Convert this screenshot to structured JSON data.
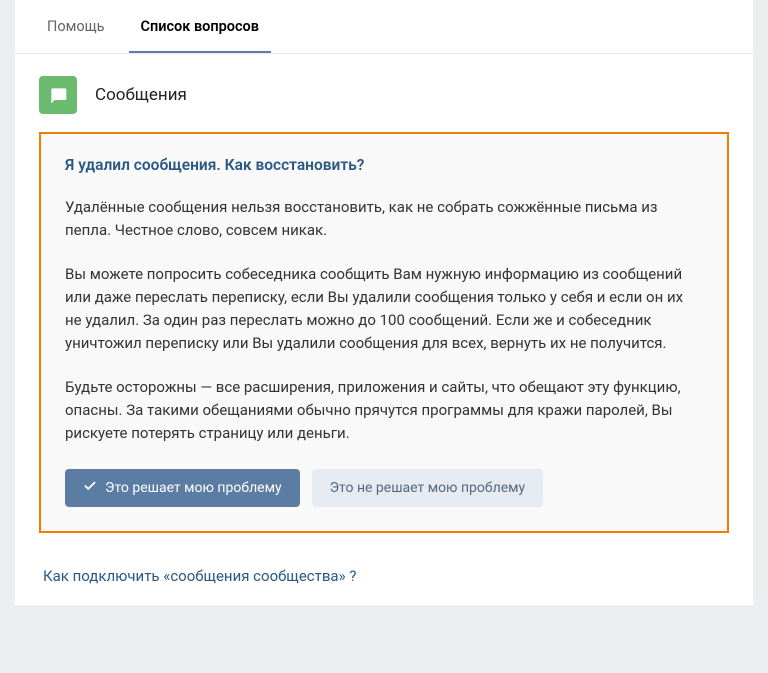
{
  "tabs": {
    "help": "Помощь",
    "questions": "Список вопросов"
  },
  "section": {
    "title": "Сообщения"
  },
  "question": {
    "title": "Я удалил сообщения. Как восстановить?",
    "paragraph1": "Удалённые сообщения нельзя восстановить, как не собрать сожжённые письма из пепла. Честное слово, совсем никак.",
    "paragraph2": "Вы можете попросить собеседника сообщить Вам нужную информацию из сообщений или даже переслать переписку, если Вы удалили сообщения только у себя и если он их не удалил. За один раз переслать можно до 100 сообщений. Если же и собеседник уничтожил переписку или Вы удалили сообщения для всех, вернуть их не получится.",
    "paragraph3": "Будьте осторожны — все расширения, приложения и сайты, что обещают эту функцию, опасны. За такими обещаниями обычно прячутся программы для кражи паролей, Вы рискуете потерять страницу или деньги."
  },
  "buttons": {
    "solves": "Это решает мою проблему",
    "notsolves": "Это не решает мою проблему"
  },
  "related": {
    "link1": "Как подключить «сообщения сообщества» ?"
  }
}
